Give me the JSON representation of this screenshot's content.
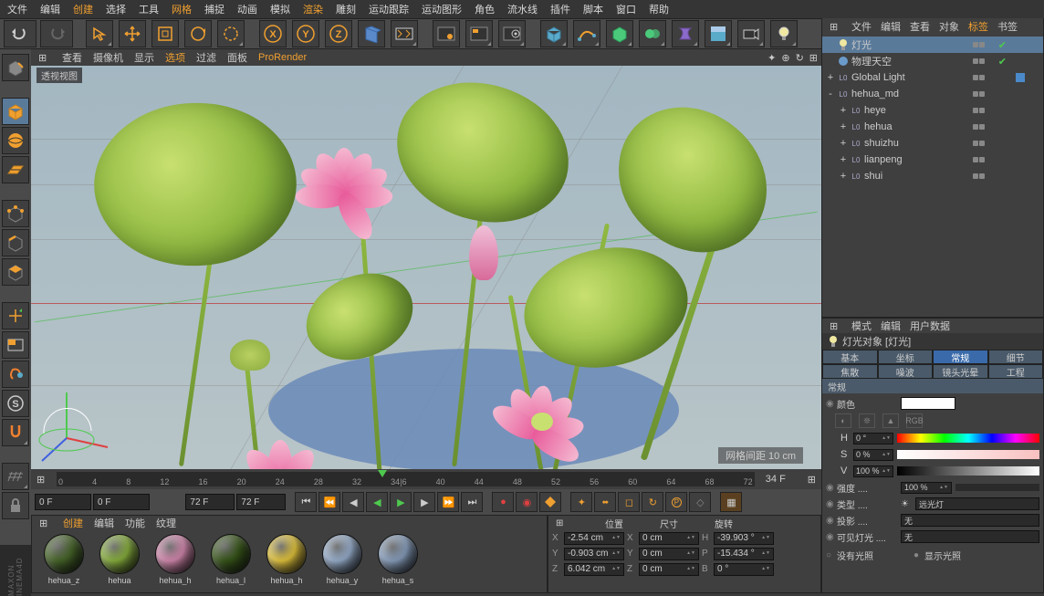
{
  "menu": {
    "items": [
      "文件",
      "编辑",
      "创建",
      "选择",
      "工具",
      "网格",
      "捕捉",
      "动画",
      "模拟",
      "渲染",
      "雕刻",
      "运动跟踪",
      "运动图形",
      "角色",
      "流水线",
      "插件",
      "脚本",
      "窗口",
      "帮助"
    ],
    "highlights": [
      2,
      5,
      9
    ]
  },
  "viewport_menu": {
    "items": [
      "查看",
      "摄像机",
      "显示",
      "选项",
      "过滤",
      "面板",
      "ProRender"
    ],
    "highlights": [
      3,
      6
    ]
  },
  "viewport": {
    "label": "透视视图",
    "grid_info": "网格间距   10 cm"
  },
  "timeline": {
    "ticks": [
      "0",
      "4",
      "8",
      "12",
      "16",
      "20",
      "24",
      "28",
      "32",
      "34|6",
      "40",
      "44",
      "48",
      "52",
      "56",
      "60",
      "64",
      "68",
      "72"
    ],
    "end": "34 F"
  },
  "transport": {
    "fields": [
      "0 F",
      "0 F",
      "72 F",
      "72 F"
    ]
  },
  "materials": {
    "menu": [
      "创建",
      "编辑",
      "功能",
      "纹理"
    ],
    "highlight": 0,
    "items": [
      {
        "name": "hehua_z",
        "color": "#4a6a2a"
      },
      {
        "name": "hehua",
        "color": "#8fb940"
      },
      {
        "name": "hehua_h",
        "color": "#e090b8"
      },
      {
        "name": "hehua_l",
        "color": "#3a5a1a"
      },
      {
        "name": "hehua_h",
        "color": "#f0d040"
      },
      {
        "name": "hehua_y",
        "color": "#a0b8d8"
      },
      {
        "name": "hehua_s",
        "color": "#90a8c8"
      }
    ]
  },
  "coords": {
    "hdr": [
      "位置",
      "尺寸",
      "旋转"
    ],
    "rows": [
      {
        "axis": "X",
        "pos": "-2.54 cm",
        "size": "0 cm",
        "rot": "-39.903 °",
        "rl": "H"
      },
      {
        "axis": "Y",
        "pos": "-0.903 cm",
        "size": "0 cm",
        "rot": "-15.434 °",
        "rl": "P"
      },
      {
        "axis": "Z",
        "pos": "6.042 cm",
        "size": "0 cm",
        "rot": "0 °",
        "rl": "B"
      }
    ]
  },
  "objects": {
    "menu": [
      "文件",
      "编辑",
      "查看",
      "对象",
      "标签",
      "书签"
    ],
    "highlight": 4,
    "tree": [
      {
        "label": "灯光",
        "sel": true,
        "icon": "light",
        "chk": true,
        "exp": ""
      },
      {
        "label": "物理天空",
        "icon": "sky",
        "chk": true,
        "exp": ""
      },
      {
        "label": "Global Light",
        "icon": "null",
        "exp": "+",
        "tag": true
      },
      {
        "label": "hehua_md",
        "icon": "null",
        "exp": "-"
      },
      {
        "label": "heye",
        "icon": "null",
        "exp": "+",
        "ind": 1
      },
      {
        "label": "hehua",
        "icon": "null",
        "exp": "+",
        "ind": 1
      },
      {
        "label": "shuizhu",
        "icon": "null",
        "exp": "+",
        "ind": 1
      },
      {
        "label": "lianpeng",
        "icon": "null",
        "exp": "+",
        "ind": 1
      },
      {
        "label": "shui",
        "icon": "null",
        "exp": "+",
        "ind": 1
      }
    ]
  },
  "attrs": {
    "menu": [
      "模式",
      "编辑",
      "用户数据"
    ],
    "title": "灯光对象 [灯光]",
    "tabs_row1": [
      "基本",
      "坐标",
      "常规",
      "细节"
    ],
    "tabs_row2": [
      "焦散",
      "噪波",
      "镜头光晕",
      "工程"
    ],
    "active_tab": 2,
    "section": "常规",
    "color_label": "颜色",
    "hsv": [
      {
        "l": "H",
        "v": "0 °"
      },
      {
        "l": "S",
        "v": "0 %"
      },
      {
        "l": "V",
        "v": "100 %"
      }
    ],
    "rows": [
      {
        "lbl": "强度",
        "val": "100 %"
      },
      {
        "lbl": "类型",
        "combo": "远光灯",
        "icon": true
      },
      {
        "lbl": "投影",
        "combo": "无"
      },
      {
        "lbl": "可见灯光",
        "combo": "无"
      }
    ],
    "foot": [
      "没有光照",
      "显示光照"
    ]
  }
}
